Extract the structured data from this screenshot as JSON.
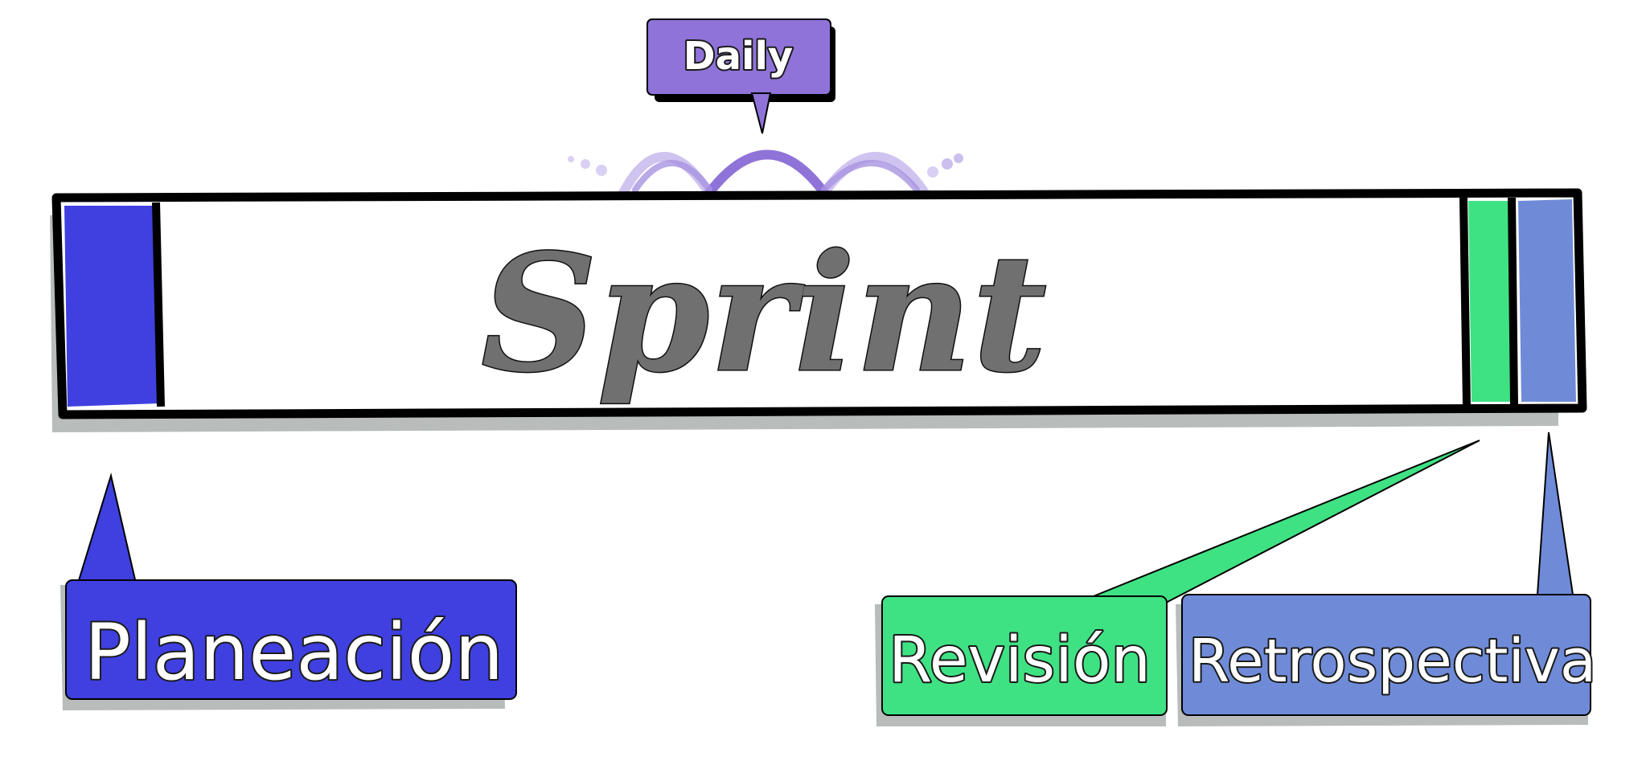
{
  "sprint": {
    "label": "Sprint"
  },
  "phases": {
    "daily": {
      "label": "Daily",
      "color": "#8f73d9"
    },
    "planning": {
      "label": "Planeación",
      "color": "#3f40df"
    },
    "review": {
      "label": "Revisión",
      "color": "#3fe283"
    },
    "retro": {
      "label": "Retrospectiva",
      "color": "#6f8bd8"
    }
  },
  "colors": {
    "outline": "#000000",
    "shadow": "#b8bcbb",
    "sprint_text": "#707070"
  }
}
